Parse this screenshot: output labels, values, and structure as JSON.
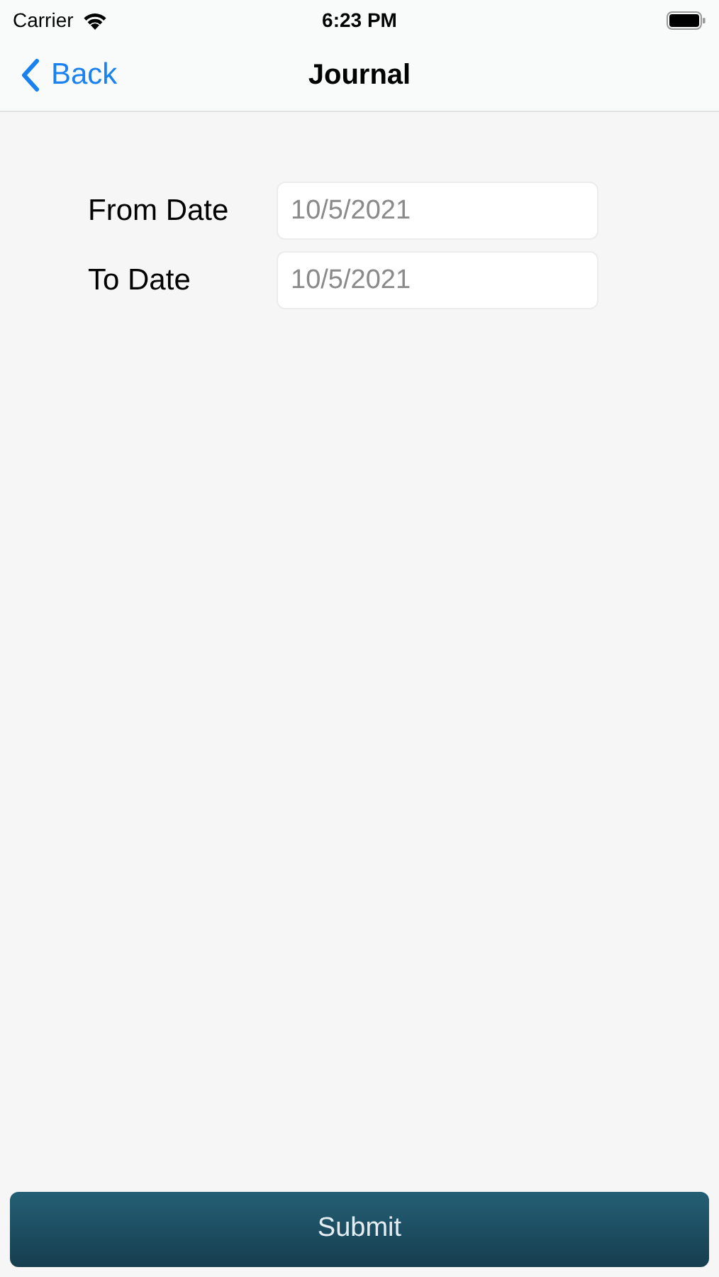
{
  "status_bar": {
    "carrier": "Carrier",
    "time": "6:23 PM"
  },
  "nav_bar": {
    "back": "Back",
    "title": "Journal"
  },
  "fields": [
    {
      "label": "From Date",
      "value": "10/5/2021"
    },
    {
      "label": "To Date",
      "value": "10/5/2021"
    }
  ],
  "submit_button": "Submit"
}
